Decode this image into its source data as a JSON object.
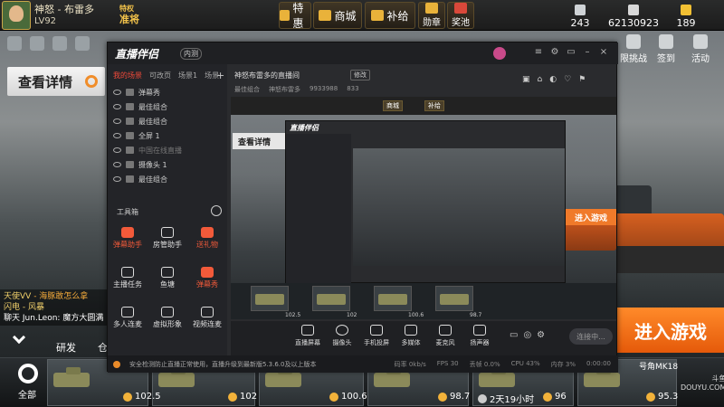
{
  "game": {
    "player": {
      "name": "神怒 - 布雷多",
      "level": "LV92",
      "rank_line1": "特权",
      "rank_line2": "准将"
    },
    "top_buttons": [
      {
        "label": "特惠",
        "icon": "gift-icon"
      },
      {
        "label": "商城",
        "icon": "cart-icon"
      },
      {
        "label": "补给",
        "icon": "supply-icon"
      },
      {
        "label": "勋章",
        "icon": "medal-icon"
      },
      {
        "label": "奖池",
        "icon": "prize-icon"
      }
    ],
    "stats": [
      {
        "value": "243",
        "icon": "cup-icon",
        "color": "#cfd3d6"
      },
      {
        "value": "62130923",
        "icon": "silver-icon",
        "color": "#d8d8d8"
      },
      {
        "value": "189",
        "icon": "gold-icon",
        "color": "#f2c033"
      }
    ],
    "detail_button": "查看详情",
    "right_menu": [
      {
        "label": "限挑战",
        "icon": "challenge-icon"
      },
      {
        "label": "签到",
        "icon": "checkin-icon"
      },
      {
        "label": "活动",
        "icon": "event-icon"
      }
    ],
    "chat": [
      {
        "prefix": "",
        "name": "天使VV",
        "text": "- 海豚敢怎么拿"
      },
      {
        "prefix": "",
        "name": "闪电 - 风暴",
        "text": ""
      },
      {
        "prefix": "聊天",
        "name": "Jun.Leon",
        "text": ": 魔方大圆满"
      }
    ],
    "nav": [
      {
        "label": "研发"
      },
      {
        "label": "仓"
      }
    ],
    "all_label": "全部",
    "cards": [
      {
        "cost": "102.5"
      },
      {
        "cost": "102"
      },
      {
        "cost": "100.6"
      },
      {
        "cost": "98.7"
      },
      {
        "cost": "2天19小时"
      },
      {
        "cost": "96"
      },
      {
        "cost": "95.3"
      }
    ],
    "card_tag": "号角MK18",
    "enter_button": "进入游戏"
  },
  "app": {
    "title": "直播伴侣",
    "beta": "内测",
    "scene_tabs": [
      "我的场景",
      "可改页",
      "场景1",
      "场景"
    ],
    "sources": [
      {
        "label": "弹幕秀",
        "dim": false
      },
      {
        "label": "最佳组合",
        "dim": false
      },
      {
        "label": "最佳组合",
        "dim": false
      },
      {
        "label": "全屏 1",
        "dim": false
      },
      {
        "label": "中国在线直播",
        "dim": true
      },
      {
        "label": "摄像头 1",
        "dim": false
      },
      {
        "label": "最佳组合",
        "dim": false
      }
    ],
    "tools_title": "工具箱",
    "tools": [
      {
        "label": "弹幕助手",
        "red": true
      },
      {
        "label": "房管助手",
        "red": false
      },
      {
        "label": "送礼物",
        "red": true
      },
      {
        "label": "主播任务",
        "red": false
      },
      {
        "label": "鱼塘",
        "red": false
      },
      {
        "label": "弹幕秀",
        "red": true
      },
      {
        "label": "多人连麦",
        "red": false
      },
      {
        "label": "虚拟形象",
        "red": false
      },
      {
        "label": "视频连麦",
        "red": false
      }
    ],
    "room_title": "神怒布雷多的直播间",
    "room_tag": "修改",
    "room_meta": [
      "最佳组合",
      "神怒布雷多",
      "9933988",
      "833"
    ],
    "controls": [
      "直播屏幕",
      "摄像头",
      "手机投屏",
      "多媒体",
      "麦克风",
      "扬声器"
    ],
    "live_button": "连接中...",
    "status_text": "安全检测防止直播正常使用，直播升级到最新版5.3.6.0及以上版本",
    "status_stats": [
      "码率 0kb/s",
      "FPS 30",
      "丢帧 0.0%",
      "CPU 43%",
      "内存 3%",
      "0:00:00"
    ]
  },
  "preview": {
    "top_buttons": [
      "商城",
      "补给"
    ],
    "detail": "查看详情",
    "app_title": "直播伴侣",
    "enter": "进入游戏",
    "card_values": [
      "102.5",
      "102",
      "100.6",
      "98.7"
    ]
  },
  "watermark": "斗鱼\nDOUYU.COM"
}
